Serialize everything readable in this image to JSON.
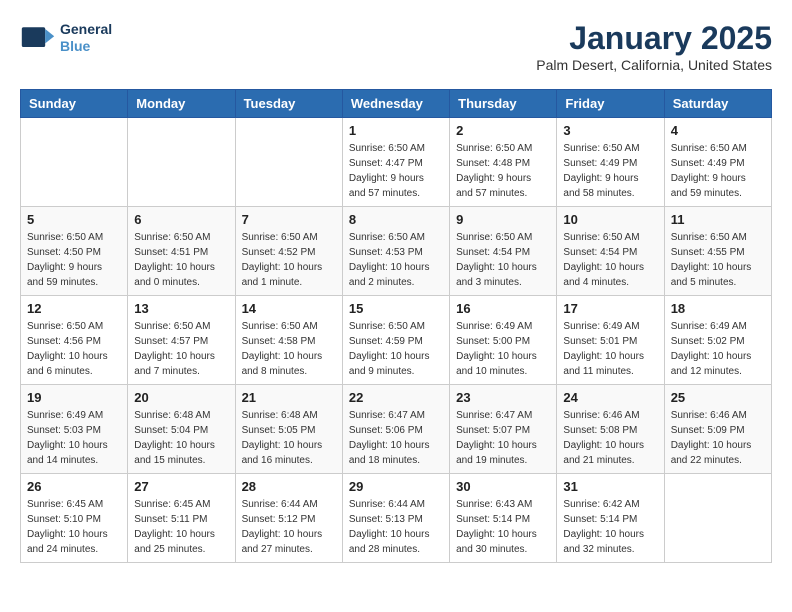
{
  "logo": {
    "line1": "General",
    "line2": "Blue"
  },
  "title": "January 2025",
  "location": "Palm Desert, California, United States",
  "days_of_week": [
    "Sunday",
    "Monday",
    "Tuesday",
    "Wednesday",
    "Thursday",
    "Friday",
    "Saturday"
  ],
  "weeks": [
    [
      {
        "day": "",
        "sunrise": "",
        "sunset": "",
        "daylight": ""
      },
      {
        "day": "",
        "sunrise": "",
        "sunset": "",
        "daylight": ""
      },
      {
        "day": "",
        "sunrise": "",
        "sunset": "",
        "daylight": ""
      },
      {
        "day": "1",
        "sunrise": "Sunrise: 6:50 AM",
        "sunset": "Sunset: 4:47 PM",
        "daylight": "Daylight: 9 hours and 57 minutes."
      },
      {
        "day": "2",
        "sunrise": "Sunrise: 6:50 AM",
        "sunset": "Sunset: 4:48 PM",
        "daylight": "Daylight: 9 hours and 57 minutes."
      },
      {
        "day": "3",
        "sunrise": "Sunrise: 6:50 AM",
        "sunset": "Sunset: 4:49 PM",
        "daylight": "Daylight: 9 hours and 58 minutes."
      },
      {
        "day": "4",
        "sunrise": "Sunrise: 6:50 AM",
        "sunset": "Sunset: 4:49 PM",
        "daylight": "Daylight: 9 hours and 59 minutes."
      }
    ],
    [
      {
        "day": "5",
        "sunrise": "Sunrise: 6:50 AM",
        "sunset": "Sunset: 4:50 PM",
        "daylight": "Daylight: 9 hours and 59 minutes."
      },
      {
        "day": "6",
        "sunrise": "Sunrise: 6:50 AM",
        "sunset": "Sunset: 4:51 PM",
        "daylight": "Daylight: 10 hours and 0 minutes."
      },
      {
        "day": "7",
        "sunrise": "Sunrise: 6:50 AM",
        "sunset": "Sunset: 4:52 PM",
        "daylight": "Daylight: 10 hours and 1 minute."
      },
      {
        "day": "8",
        "sunrise": "Sunrise: 6:50 AM",
        "sunset": "Sunset: 4:53 PM",
        "daylight": "Daylight: 10 hours and 2 minutes."
      },
      {
        "day": "9",
        "sunrise": "Sunrise: 6:50 AM",
        "sunset": "Sunset: 4:54 PM",
        "daylight": "Daylight: 10 hours and 3 minutes."
      },
      {
        "day": "10",
        "sunrise": "Sunrise: 6:50 AM",
        "sunset": "Sunset: 4:54 PM",
        "daylight": "Daylight: 10 hours and 4 minutes."
      },
      {
        "day": "11",
        "sunrise": "Sunrise: 6:50 AM",
        "sunset": "Sunset: 4:55 PM",
        "daylight": "Daylight: 10 hours and 5 minutes."
      }
    ],
    [
      {
        "day": "12",
        "sunrise": "Sunrise: 6:50 AM",
        "sunset": "Sunset: 4:56 PM",
        "daylight": "Daylight: 10 hours and 6 minutes."
      },
      {
        "day": "13",
        "sunrise": "Sunrise: 6:50 AM",
        "sunset": "Sunset: 4:57 PM",
        "daylight": "Daylight: 10 hours and 7 minutes."
      },
      {
        "day": "14",
        "sunrise": "Sunrise: 6:50 AM",
        "sunset": "Sunset: 4:58 PM",
        "daylight": "Daylight: 10 hours and 8 minutes."
      },
      {
        "day": "15",
        "sunrise": "Sunrise: 6:50 AM",
        "sunset": "Sunset: 4:59 PM",
        "daylight": "Daylight: 10 hours and 9 minutes."
      },
      {
        "day": "16",
        "sunrise": "Sunrise: 6:49 AM",
        "sunset": "Sunset: 5:00 PM",
        "daylight": "Daylight: 10 hours and 10 minutes."
      },
      {
        "day": "17",
        "sunrise": "Sunrise: 6:49 AM",
        "sunset": "Sunset: 5:01 PM",
        "daylight": "Daylight: 10 hours and 11 minutes."
      },
      {
        "day": "18",
        "sunrise": "Sunrise: 6:49 AM",
        "sunset": "Sunset: 5:02 PM",
        "daylight": "Daylight: 10 hours and 12 minutes."
      }
    ],
    [
      {
        "day": "19",
        "sunrise": "Sunrise: 6:49 AM",
        "sunset": "Sunset: 5:03 PM",
        "daylight": "Daylight: 10 hours and 14 minutes."
      },
      {
        "day": "20",
        "sunrise": "Sunrise: 6:48 AM",
        "sunset": "Sunset: 5:04 PM",
        "daylight": "Daylight: 10 hours and 15 minutes."
      },
      {
        "day": "21",
        "sunrise": "Sunrise: 6:48 AM",
        "sunset": "Sunset: 5:05 PM",
        "daylight": "Daylight: 10 hours and 16 minutes."
      },
      {
        "day": "22",
        "sunrise": "Sunrise: 6:47 AM",
        "sunset": "Sunset: 5:06 PM",
        "daylight": "Daylight: 10 hours and 18 minutes."
      },
      {
        "day": "23",
        "sunrise": "Sunrise: 6:47 AM",
        "sunset": "Sunset: 5:07 PM",
        "daylight": "Daylight: 10 hours and 19 minutes."
      },
      {
        "day": "24",
        "sunrise": "Sunrise: 6:46 AM",
        "sunset": "Sunset: 5:08 PM",
        "daylight": "Daylight: 10 hours and 21 minutes."
      },
      {
        "day": "25",
        "sunrise": "Sunrise: 6:46 AM",
        "sunset": "Sunset: 5:09 PM",
        "daylight": "Daylight: 10 hours and 22 minutes."
      }
    ],
    [
      {
        "day": "26",
        "sunrise": "Sunrise: 6:45 AM",
        "sunset": "Sunset: 5:10 PM",
        "daylight": "Daylight: 10 hours and 24 minutes."
      },
      {
        "day": "27",
        "sunrise": "Sunrise: 6:45 AM",
        "sunset": "Sunset: 5:11 PM",
        "daylight": "Daylight: 10 hours and 25 minutes."
      },
      {
        "day": "28",
        "sunrise": "Sunrise: 6:44 AM",
        "sunset": "Sunset: 5:12 PM",
        "daylight": "Daylight: 10 hours and 27 minutes."
      },
      {
        "day": "29",
        "sunrise": "Sunrise: 6:44 AM",
        "sunset": "Sunset: 5:13 PM",
        "daylight": "Daylight: 10 hours and 28 minutes."
      },
      {
        "day": "30",
        "sunrise": "Sunrise: 6:43 AM",
        "sunset": "Sunset: 5:14 PM",
        "daylight": "Daylight: 10 hours and 30 minutes."
      },
      {
        "day": "31",
        "sunrise": "Sunrise: 6:42 AM",
        "sunset": "Sunset: 5:14 PM",
        "daylight": "Daylight: 10 hours and 32 minutes."
      },
      {
        "day": "",
        "sunrise": "",
        "sunset": "",
        "daylight": ""
      }
    ]
  ]
}
